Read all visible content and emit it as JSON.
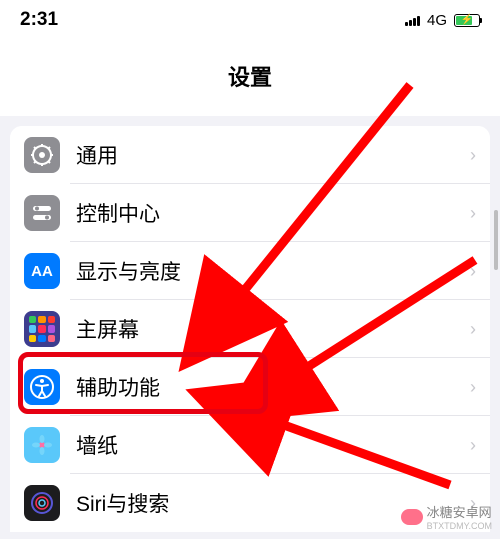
{
  "statusBar": {
    "time": "2:31",
    "network": "4G"
  },
  "page": {
    "title": "设置"
  },
  "items": [
    {
      "label": "通用",
      "icon": "gear"
    },
    {
      "label": "控制中心",
      "icon": "toggles"
    },
    {
      "label": "显示与亮度",
      "icon": "AA"
    },
    {
      "label": "主屏幕",
      "icon": "grid"
    },
    {
      "label": "辅助功能",
      "icon": "accessibility"
    },
    {
      "label": "墙纸",
      "icon": "flower"
    },
    {
      "label": "Siri与搜索",
      "icon": "siri"
    }
  ],
  "annotations": {
    "highlight_color": "#e60012",
    "arrow_color": "#ff0000",
    "highlighted_item_index": 4
  },
  "watermark": {
    "text": "冰糖安卓网",
    "url": "BTXTDMY.COM"
  }
}
